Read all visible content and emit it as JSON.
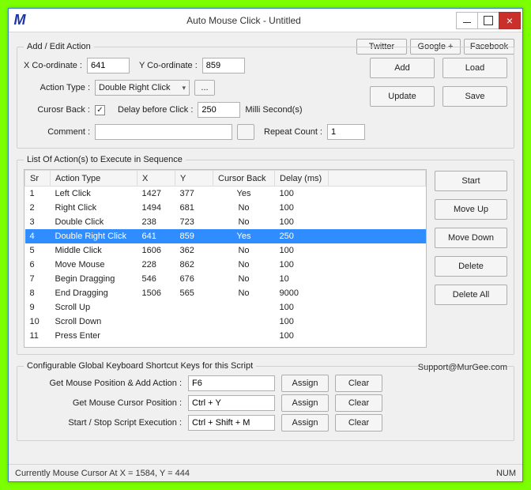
{
  "titlebar": {
    "title": "Auto Mouse Click - Untitled"
  },
  "social": {
    "twitter": "Twitter",
    "google": "Google +",
    "facebook": "Facebook"
  },
  "edit": {
    "legend": "Add / Edit Action",
    "x_label": "X Co-ordinate :",
    "x_value": "641",
    "y_label": "Y Co-ordinate :",
    "y_value": "859",
    "action_type_label": "Action Type :",
    "action_type_value": "Double Right Click",
    "dots": "...",
    "cursor_back_label": "Curosr Back :",
    "cursor_back_checked": "✓",
    "delay_label": "Delay before Click :",
    "delay_value": "250",
    "delay_unit": "Milli Second(s)",
    "comment_label": "Comment :",
    "comment_value": "",
    "repeat_label": "Repeat Count :",
    "repeat_value": "1",
    "btn_add": "Add",
    "btn_load": "Load",
    "btn_update": "Update",
    "btn_save": "Save"
  },
  "list": {
    "legend": "List Of Action(s) to Execute in Sequence",
    "headers": {
      "sr": "Sr",
      "type": "Action Type",
      "x": "X",
      "y": "Y",
      "cb": "Cursor Back",
      "delay": "Delay (ms)",
      "extra": ""
    },
    "rows": [
      {
        "sr": "1",
        "type": "Left Click",
        "x": "1427",
        "y": "377",
        "cb": "Yes",
        "delay": "100",
        "sel": false
      },
      {
        "sr": "2",
        "type": "Right Click",
        "x": "1494",
        "y": "681",
        "cb": "No",
        "delay": "100",
        "sel": false
      },
      {
        "sr": "3",
        "type": "Double Click",
        "x": "238",
        "y": "723",
        "cb": "No",
        "delay": "100",
        "sel": false
      },
      {
        "sr": "4",
        "type": "Double Right Click",
        "x": "641",
        "y": "859",
        "cb": "Yes",
        "delay": "250",
        "sel": true
      },
      {
        "sr": "5",
        "type": "Middle Click",
        "x": "1606",
        "y": "362",
        "cb": "No",
        "delay": "100",
        "sel": false
      },
      {
        "sr": "6",
        "type": "Move Mouse",
        "x": "228",
        "y": "862",
        "cb": "No",
        "delay": "100",
        "sel": false
      },
      {
        "sr": "7",
        "type": "Begin Dragging",
        "x": "546",
        "y": "676",
        "cb": "No",
        "delay": "10",
        "sel": false
      },
      {
        "sr": "8",
        "type": "End Dragging",
        "x": "1506",
        "y": "565",
        "cb": "No",
        "delay": "9000",
        "sel": false
      },
      {
        "sr": "9",
        "type": "Scroll Up",
        "x": "",
        "y": "",
        "cb": "",
        "delay": "100",
        "sel": false
      },
      {
        "sr": "10",
        "type": "Scroll Down",
        "x": "",
        "y": "",
        "cb": "",
        "delay": "100",
        "sel": false
      },
      {
        "sr": "11",
        "type": "Press Enter",
        "x": "",
        "y": "",
        "cb": "",
        "delay": "100",
        "sel": false
      }
    ],
    "btns": {
      "start": "Start",
      "up": "Move Up",
      "down": "Move Down",
      "del": "Delete",
      "delall": "Delete All"
    }
  },
  "shortcuts": {
    "legend": "Configurable Global Keyboard Shortcut Keys for this Script",
    "support": "Support@MurGee.com",
    "assign": "Assign",
    "clear": "Clear",
    "r1": {
      "label": "Get Mouse Position & Add Action :",
      "value": "F6"
    },
    "r2": {
      "label": "Get Mouse Cursor Position :",
      "value": "Ctrl + Y"
    },
    "r3": {
      "label": "Start / Stop Script Execution :",
      "value": "Ctrl + Shift + M"
    }
  },
  "status": {
    "text": "Currently Mouse Cursor At X = 1584, Y = 444",
    "indicator": "NUM"
  }
}
